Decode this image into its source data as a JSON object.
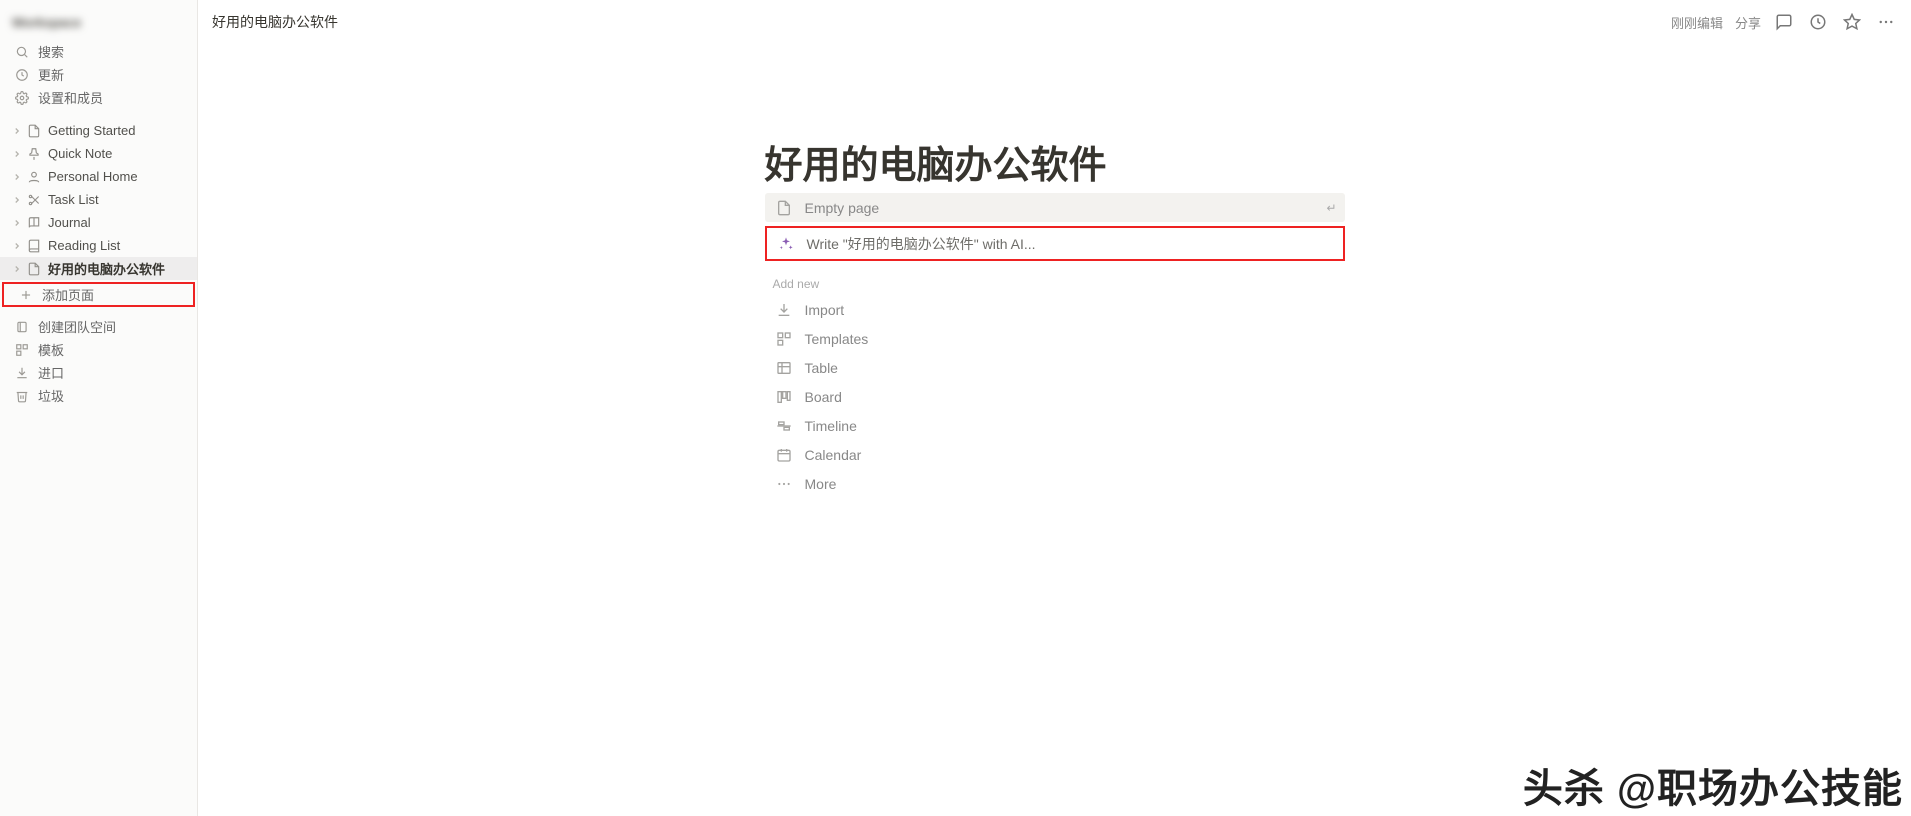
{
  "sidebar": {
    "workspace_name": "Workspace",
    "search": "搜索",
    "updates": "更新",
    "settings": "设置和成员",
    "pages": [
      {
        "label": "Getting Started",
        "icon": "doc"
      },
      {
        "label": "Quick Note",
        "icon": "pin"
      },
      {
        "label": "Personal Home",
        "icon": "home"
      },
      {
        "label": "Task List",
        "icon": "check"
      },
      {
        "label": "Journal",
        "icon": "book"
      },
      {
        "label": "Reading List",
        "icon": "book2"
      },
      {
        "label": "好用的电脑办公软件",
        "icon": "doc",
        "selected": true
      }
    ],
    "add_page": "添加页面",
    "footer": {
      "team": "创建团队空间",
      "templates": "模板",
      "import": "进口",
      "trash": "垃圾"
    }
  },
  "topbar": {
    "breadcrumb": "好用的电脑办公软件",
    "just_edited": "刚刚编辑",
    "share": "分享"
  },
  "page": {
    "title": "好用的电脑办公软件",
    "empty_page": "Empty page",
    "ai_write": "Write \"好用的电脑办公软件\" with AI...",
    "add_new": "Add new",
    "options": {
      "import": "Import",
      "templates": "Templates",
      "table": "Table",
      "board": "Board",
      "timeline": "Timeline",
      "calendar": "Calendar",
      "more": "More"
    }
  },
  "watermark": "头杀 @职场办公技能"
}
